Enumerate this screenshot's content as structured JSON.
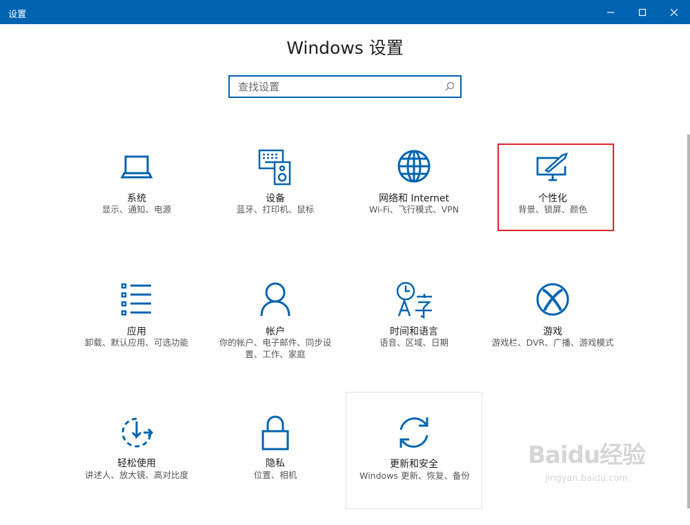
{
  "window": {
    "title": "设置"
  },
  "page": {
    "heading": "Windows 设置"
  },
  "search": {
    "placeholder": "查找设置"
  },
  "tiles": [
    {
      "name": "系统",
      "desc": "显示、通知、电源",
      "icon": "laptop-icon"
    },
    {
      "name": "设备",
      "desc": "蓝牙、打印机、鼠标",
      "icon": "devices-icon"
    },
    {
      "name": "网络和 Internet",
      "desc": "Wi-Fi、飞行模式、VPN",
      "icon": "globe-icon"
    },
    {
      "name": "个性化",
      "desc": "背景、锁屏、颜色",
      "icon": "personalization-icon"
    },
    {
      "name": "应用",
      "desc": "卸载、默认应用、可选功能",
      "icon": "apps-list-icon"
    },
    {
      "name": "帐户",
      "desc": "你的帐户、电子邮件、同步设置、工作、家庭",
      "icon": "person-icon"
    },
    {
      "name": "时间和语言",
      "desc": "语音、区域、日期",
      "icon": "time-language-icon"
    },
    {
      "name": "游戏",
      "desc": "游戏栏、DVR、广播、游戏模式",
      "icon": "xbox-icon"
    },
    {
      "name": "轻松使用",
      "desc": "讲述人、放大镜、高对比度",
      "icon": "ease-of-access-icon"
    },
    {
      "name": "隐私",
      "desc": "位置、相机",
      "icon": "lock-icon"
    },
    {
      "name": "更新和安全",
      "desc": "Windows 更新、恢复、备份",
      "icon": "sync-icon"
    }
  ],
  "watermark": {
    "brand": "Baidu经验",
    "url": "jingyan.baidu.com"
  },
  "colors": {
    "accent": "#0063b1",
    "highlight": "#e0202b"
  }
}
